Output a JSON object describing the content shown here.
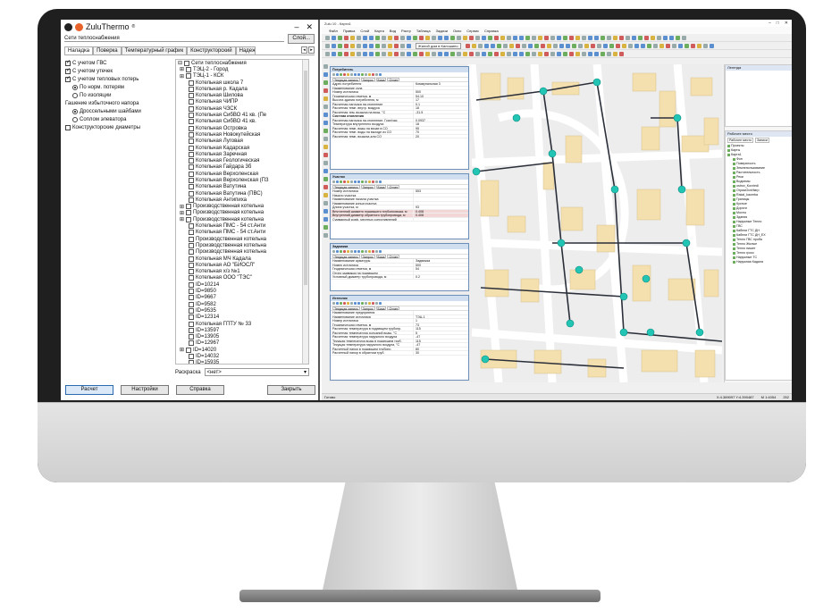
{
  "zt": {
    "title": "ZuluThermo",
    "title_mark": "®",
    "minimize": "–",
    "close": "✕",
    "network_label": "Сети теплоснабжения",
    "select_button": "Слой...",
    "tabs": [
      "Наладка",
      "Поверка",
      "Температурный график",
      "Конструкторский",
      "Надежность"
    ],
    "tab_arrows": [
      "◂",
      "▸"
    ],
    "options": [
      {
        "label": "С учетом ГВС",
        "type": "check",
        "on": true
      },
      {
        "label": "С учетом утечек",
        "type": "check",
        "on": true
      },
      {
        "label": "С учетом тепловых потерь",
        "type": "check",
        "on": true
      },
      {
        "label": "По норм. потерям",
        "type": "radio",
        "on": true,
        "indent": true
      },
      {
        "label": "По изоляции",
        "type": "radio",
        "on": false,
        "indent": true
      },
      {
        "label": "Гашение избыточного напора",
        "type": "text"
      },
      {
        "label": "Дроссельными шайбами",
        "type": "radio",
        "on": true,
        "indent": true
      },
      {
        "label": "Соплом элеватора",
        "type": "radio",
        "on": false,
        "indent": true
      },
      {
        "label": "Конструкторские диаметры",
        "type": "check",
        "on": false
      }
    ],
    "tree": [
      {
        "label": "Сети теплоснабжения",
        "level": "root",
        "exp": "⊟"
      },
      {
        "label": "ТЭЦ-2 - Город",
        "level": "exp",
        "exp": "⊞"
      },
      {
        "label": "ТЭЦ-1 - КСК",
        "level": "exp",
        "exp": "⊞"
      },
      {
        "label": "Котельная школа 7",
        "level": "leaf"
      },
      {
        "label": "Котельная р. Кадала",
        "level": "leaf"
      },
      {
        "label": "Котельная Шилова",
        "level": "leaf"
      },
      {
        "label": "Котельная ЧИПР",
        "level": "leaf"
      },
      {
        "label": "Котельная ЧЗСК",
        "level": "leaf"
      },
      {
        "label": "Котельная СибВО 41 кв. (Пе",
        "level": "leaf"
      },
      {
        "label": "Котельная СибВО 41 кв.",
        "level": "leaf"
      },
      {
        "label": "Котельная Островка",
        "level": "leaf"
      },
      {
        "label": "Котельная Новокутейская",
        "level": "leaf"
      },
      {
        "label": "Котельная Луговая",
        "level": "leaf"
      },
      {
        "label": "Котельная Кадарская",
        "level": "leaf"
      },
      {
        "label": "Котельная Заречная",
        "level": "leaf"
      },
      {
        "label": "Котельная Геологическая",
        "level": "leaf"
      },
      {
        "label": "Котельная Гайдара 3б",
        "level": "leaf"
      },
      {
        "label": "Котельная Верхоленская",
        "level": "leaf"
      },
      {
        "label": "Котельная Верхоленская (ПЗ",
        "level": "leaf"
      },
      {
        "label": "Котельная Ватутина",
        "level": "leaf"
      },
      {
        "label": "Котельная Ватутина (ПВС)",
        "level": "leaf"
      },
      {
        "label": "Котельная Антипиха",
        "level": "leaf"
      },
      {
        "label": "Производственная котельна",
        "level": "exp",
        "exp": "⊞"
      },
      {
        "label": "Производственная котельна",
        "level": "exp",
        "exp": "⊞"
      },
      {
        "label": "Производственная котельна",
        "level": "exp",
        "exp": "⊞"
      },
      {
        "label": "Котельная ПМС - 54 ст.Анти",
        "level": "leaf"
      },
      {
        "label": "Котельная ПМС - 54 ст.Анти",
        "level": "leaf"
      },
      {
        "label": "Производственная котельна",
        "level": "leaf"
      },
      {
        "label": "Производственная котельна",
        "level": "leaf"
      },
      {
        "label": "Производственная котельна",
        "level": "leaf"
      },
      {
        "label": "Котельная МЧ Кадала",
        "level": "leaf"
      },
      {
        "label": "Котельная АО \"БИОСЛ\"",
        "level": "leaf"
      },
      {
        "label": "Котельная х/з №1",
        "level": "leaf"
      },
      {
        "label": "Котельная ООО \"ТЭС\"",
        "level": "leaf"
      },
      {
        "label": "ID=10214",
        "level": "leaf"
      },
      {
        "label": "ID=9850",
        "level": "leaf"
      },
      {
        "label": "ID=9667",
        "level": "leaf"
      },
      {
        "label": "ID=9582",
        "level": "leaf"
      },
      {
        "label": "ID=9535",
        "level": "leaf"
      },
      {
        "label": "ID=12314",
        "level": "leaf"
      },
      {
        "label": "Котельная ГПТУ № 33",
        "level": "leaf"
      },
      {
        "label": "ID=13597",
        "level": "leaf"
      },
      {
        "label": "ID=13905",
        "level": "leaf"
      },
      {
        "label": "ID=12967",
        "level": "leaf"
      },
      {
        "label": "ID=14020",
        "level": "exp",
        "exp": "⊞"
      },
      {
        "label": "ID=14032",
        "level": "leaf"
      },
      {
        "label": "ID=15935",
        "level": "leaf"
      }
    ],
    "coloring_label": "Раскраска",
    "coloring_value": "<нет>",
    "buttons": {
      "calc": "Расчет",
      "settings": "Настройки",
      "help": "Справка",
      "close": "Закрыть"
    }
  },
  "gis": {
    "title": "Zulu 10 - Карта1",
    "window_controls": [
      "–",
      "□",
      "✕"
    ],
    "menu": [
      "Файл",
      "Правка",
      "Слой",
      "Карта",
      "Вид",
      "Растр",
      "Таблица",
      "Задачи",
      "Окно",
      "Сервис",
      "Справка"
    ],
    "layer_combo": "Жилой дом в Калошино",
    "dialogs": [
      {
        "title": "Потребитель",
        "tabs": [
          "Текущая запись",
          "Запрос",
          "База",
          "Отчет"
        ],
        "rows": [
          {
            "k": "Адрес потребителя",
            "v": "Коммунальная 3"
          },
          {
            "k": "Наименование узла",
            "v": ""
          },
          {
            "k": "Номер источника",
            "v": "500"
          },
          {
            "k": "Геодезическая отметка, м",
            "v": "54.10"
          },
          {
            "k": "Высота здания потребителя, м",
            "v": "17"
          },
          {
            "k": "Расчетная нагрузка на отопление",
            "v": "0.1"
          },
          {
            "k": "Расчетная темп. внутр. воздуха",
            "v": "18"
          },
          {
            "k": "Расчетная тем. воздуха на вход, °С",
            "v": "-31.5"
          },
          {
            "k": "Система отопления",
            "v": "",
            "sect": true
          },
          {
            "k": "Расчетная нагрузка на отопление, Гкал/час",
            "v": "0.0937"
          },
          {
            "k": "Температура внутреннего воздуха",
            "v": "18"
          },
          {
            "k": "Расчетная темп. воды на входе в СО",
            "v": "95"
          },
          {
            "k": "Расчетная темп. воды на выходе из СО",
            "v": "70"
          },
          {
            "k": "Расчетная темп. воздуха для СО",
            "v": "20"
          }
        ]
      },
      {
        "title": "Участок",
        "tabs": [
          "Текущая запись",
          "Запрос",
          "База",
          "Отчет"
        ],
        "rows": [
          {
            "k": "Номер источника",
            "v": "553"
          },
          {
            "k": "Начало участка",
            "v": ""
          },
          {
            "k": "Наименование начала участка",
            "v": ""
          },
          {
            "k": "Наименование конца участка",
            "v": ""
          },
          {
            "k": "Длина участка, м",
            "v": "93"
          },
          {
            "k": "Внутренний диаметр подающего трубопровода, м",
            "v": "0.408",
            "hl": true
          },
          {
            "k": "Внутренний диаметр обратного трубопровода, м",
            "v": "0.408",
            "hl": true
          },
          {
            "k": "Суммарный коэф. местных сопротивлений",
            "v": ""
          }
        ]
      },
      {
        "title": "Задвижка",
        "tabs": [
          "Текущая запись",
          "Запрос",
          "База",
          "Отчет"
        ],
        "rows": [
          {
            "k": "Наименование арматуры",
            "v": "Задвижка"
          },
          {
            "k": "Номер источника",
            "v": "500"
          },
          {
            "k": "Геодезическая отметка, м",
            "v": "54"
          },
          {
            "k": "Отрез задвижки на подающем",
            "v": ""
          },
          {
            "k": "Условный диаметр трубопровода, м",
            "v": "0.2"
          }
        ]
      },
      {
        "title": "Источник",
        "tabs": [
          "Текущая запись",
          "Запрос",
          "База",
          "Отчет"
        ],
        "rows": [
          {
            "k": "Наименование предприятия",
            "v": ""
          },
          {
            "k": "Наименование источника",
            "v": "ТЭЦ-1"
          },
          {
            "k": "Номер источника",
            "v": "1"
          },
          {
            "k": "Геодезическая отметка, м",
            "v": "73"
          },
          {
            "k": "Расчетная температура в подающем трубопр.",
            "v": "115"
          },
          {
            "k": "Расчетная температура холодной воды, °С",
            "v": "5"
          },
          {
            "k": "Расчетная температура наружного воздуха",
            "v": "-47"
          },
          {
            "k": "Текущая температура воды в подающем труб.",
            "v": "115"
          },
          {
            "k": "Текущая температура наружного воздуха, °С",
            "v": "-47"
          },
          {
            "k": "Расчетный напор в подающем трубопр.",
            "v": "80"
          },
          {
            "k": "Расчетный напор в обратном труб.",
            "v": "30"
          }
        ]
      }
    ],
    "map_panel_title": "Легенда",
    "layers_panel_title": "Рабочее место",
    "layers_tabs": [
      "Рабочее место",
      "Записи"
    ],
    "layers": [
      {
        "label": "Проекты",
        "top": true
      },
      {
        "label": "Карты",
        "top": true
      },
      {
        "label": "Карта1",
        "top": true
      },
      {
        "label": "Фон"
      },
      {
        "label": "Поверхность"
      },
      {
        "label": "Землепользование"
      },
      {
        "label": "Растительность"
      },
      {
        "label": "Реки"
      },
      {
        "label": "Водоемы"
      },
      {
        "label": "ostrov_Kovriedi"
      },
      {
        "label": "ОгражОснИмгр"
      },
      {
        "label": "Rakal_kaomba"
      },
      {
        "label": "Границы"
      },
      {
        "label": "Кустые"
      },
      {
        "label": "Дороги"
      },
      {
        "label": "Мосты"
      },
      {
        "label": "Здания"
      },
      {
        "label": "Наружные Тепло"
      },
      {
        "label": "ГВС"
      },
      {
        "label": "Кабели ГТС ДН"
      },
      {
        "label": "Кабели ГТС ДН_EX"
      },
      {
        "label": "Тепло ГВС проба"
      },
      {
        "label": "Тепло Жилые"
      },
      {
        "label": "Тепло пишет"
      },
      {
        "label": "Тепло гросс"
      },
      {
        "label": "Наружные ТС"
      },
      {
        "label": "Наружная Кадала"
      }
    ],
    "status_left": "Готово",
    "status_right": [
      "X:4.389097 Y:4.390487",
      "M 1:4054",
      "252"
    ]
  },
  "colors": {
    "map_bg": "#ededed",
    "building": "#f4dfae",
    "road": "#ffffff",
    "pipe": "#2b2f3a",
    "node": "#22c4b3"
  }
}
